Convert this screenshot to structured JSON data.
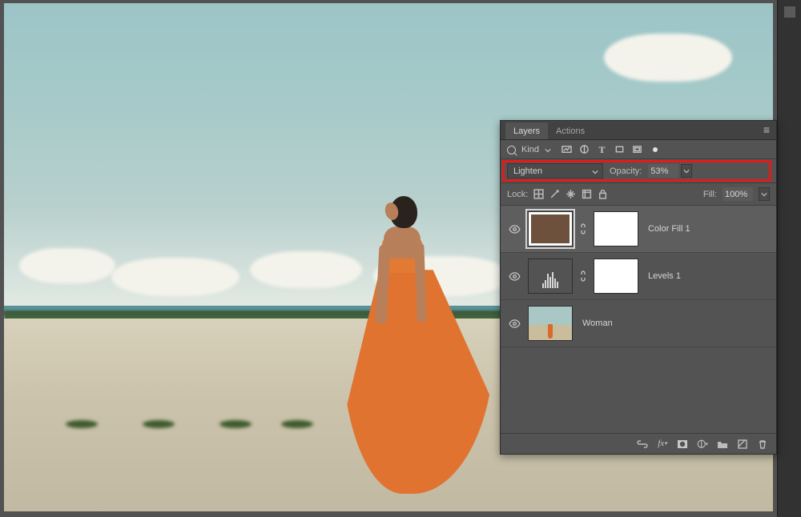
{
  "panel": {
    "tabs": [
      {
        "label": "Layers",
        "active": true
      },
      {
        "label": "Actions",
        "active": false
      }
    ],
    "filter": {
      "label": "Kind"
    },
    "blend_row": {
      "mode": "Lighten",
      "opacity_label": "Opacity:",
      "opacity_value": "53%"
    },
    "lock_row": {
      "label": "Lock:",
      "fill_label": "Fill:",
      "fill_value": "100%"
    },
    "layers": [
      {
        "name": "Color Fill 1",
        "type": "color-fill",
        "color": "#6d513d",
        "selected": true,
        "has_mask": true
      },
      {
        "name": "Levels 1",
        "type": "levels",
        "selected": false,
        "has_mask": true
      },
      {
        "name": "Woman",
        "type": "image",
        "selected": false,
        "has_mask": false
      }
    ],
    "highlight": "blend-opacity-row"
  },
  "colors": {
    "panel_bg": "#535353",
    "highlight": "#e11b1b",
    "fill_swatch": "#6d513d",
    "garment": "#e07330"
  }
}
